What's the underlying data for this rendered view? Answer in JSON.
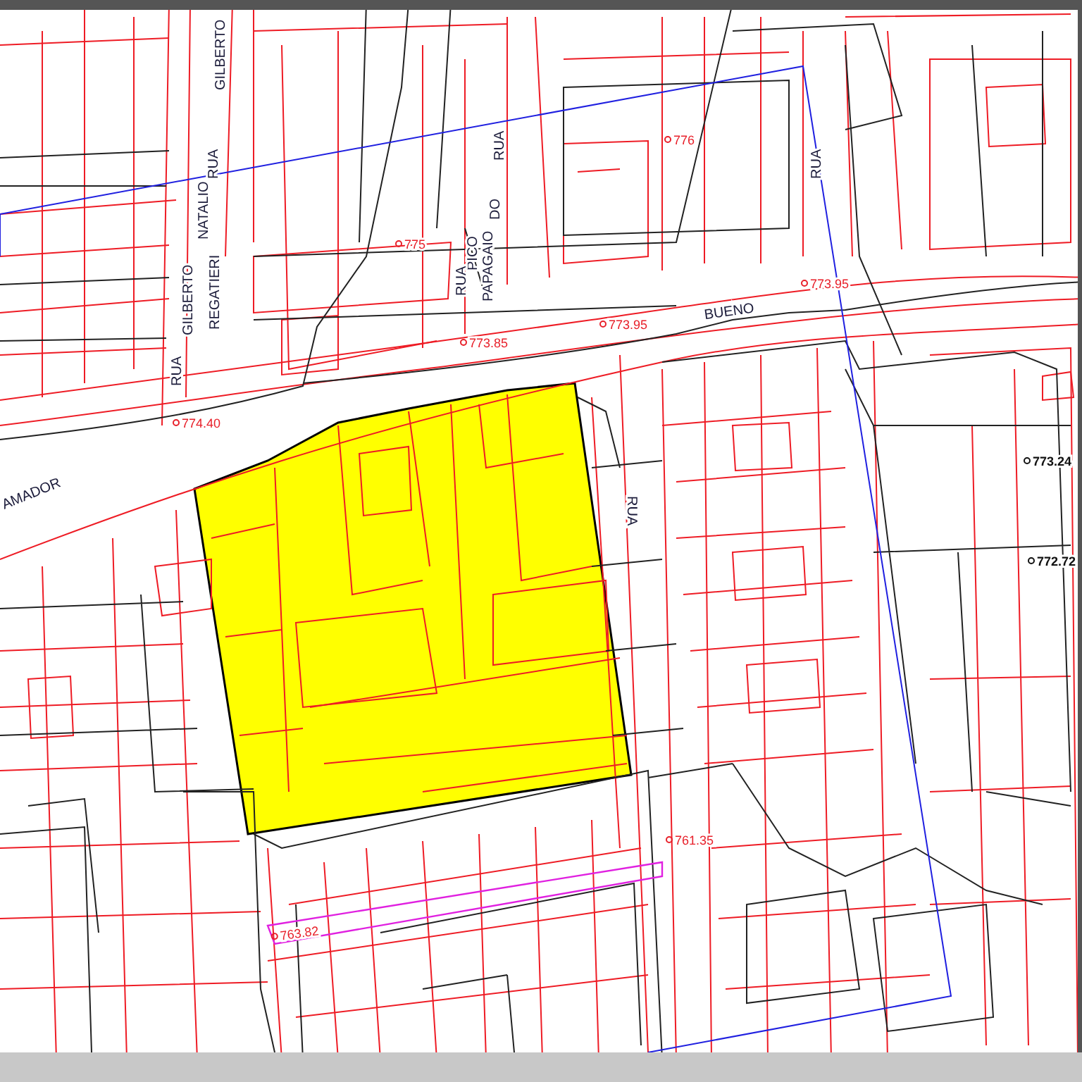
{
  "map": {
    "labels": [
      {
        "text": "GILBERTO",
        "kind": "street",
        "color": "#1b1b3a"
      },
      {
        "text": "RUA",
        "kind": "street",
        "color": "#1b1b3a"
      },
      {
        "text": "NATALIO",
        "kind": "street",
        "color": "#1b1b3a"
      },
      {
        "text": "REGATIERI",
        "kind": "street",
        "color": "#1b1b3a"
      },
      {
        "text": "GILBERTO",
        "kind": "street",
        "color": "#1b1b3a"
      },
      {
        "text": "RUA",
        "kind": "street",
        "color": "#1b1b3a"
      },
      {
        "text": "RUA",
        "kind": "street",
        "color": "#1b1b3a"
      },
      {
        "text": "776",
        "kind": "elevation",
        "color": "#e8202a"
      },
      {
        "text": "775",
        "kind": "elevation",
        "color": "#e8202a"
      },
      {
        "text": "DO",
        "kind": "street",
        "color": "#1b1b3a"
      },
      {
        "text": "PICO",
        "kind": "street",
        "color": "#1b1b3a"
      },
      {
        "text": "PAPAGAIO",
        "kind": "street",
        "color": "#1b1b3a"
      },
      {
        "text": "RUA",
        "kind": "street",
        "color": "#1b1b3a"
      },
      {
        "text": "RUA",
        "kind": "street",
        "color": "#1b1b3a"
      },
      {
        "text": "773.95",
        "kind": "elevation",
        "color": "#e8202a"
      },
      {
        "text": "BUENO",
        "kind": "street",
        "color": "#1b1b3a"
      },
      {
        "text": "773.85",
        "kind": "elevation",
        "color": "#e8202a"
      },
      {
        "text": "773.95",
        "kind": "elevation",
        "color": "#e8202a"
      },
      {
        "text": "774.40",
        "kind": "elevation",
        "color": "#e8202a"
      },
      {
        "text": "AMADOR",
        "kind": "street",
        "color": "#1b1b3a"
      },
      {
        "text": "773.24",
        "kind": "elevation",
        "color": "#111111"
      },
      {
        "text": "RUA",
        "kind": "street",
        "color": "#1b1b3a"
      },
      {
        "text": "772.72",
        "kind": "elevation",
        "color": "#111111"
      },
      {
        "text": "761.35",
        "kind": "elevation",
        "color": "#e8202a"
      },
      {
        "text": "763.82",
        "kind": "elevation",
        "color": "#e8202a"
      }
    ]
  }
}
